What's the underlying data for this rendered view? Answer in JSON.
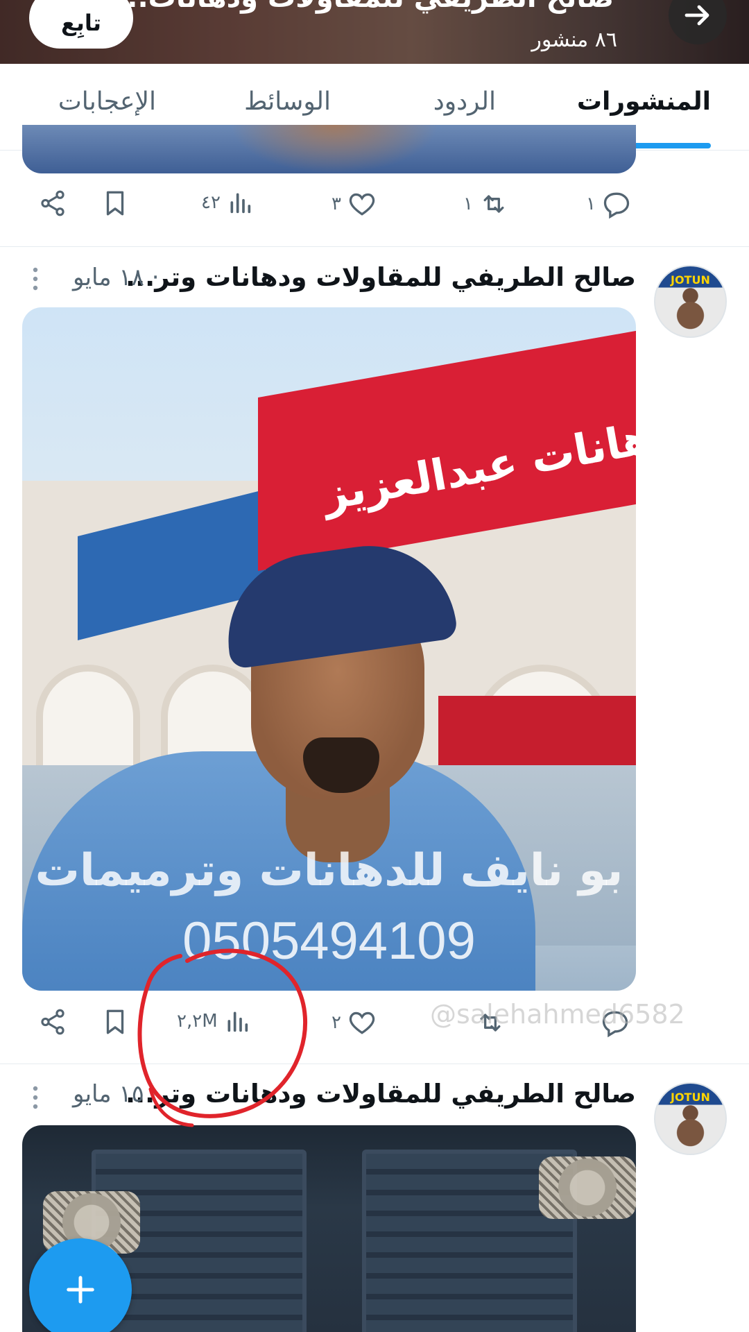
{
  "header": {
    "title": "صالح الطريفي للمقاولات ودهانات...",
    "post_count": "٨٦ منشور",
    "follow_label": "تابِع"
  },
  "tabs": [
    {
      "label": "المنشورات",
      "active": true
    },
    {
      "label": "الردود",
      "active": false
    },
    {
      "label": "الوسائط",
      "active": false
    },
    {
      "label": "الإعجابات",
      "active": false
    }
  ],
  "posts": [
    {
      "replies": "١",
      "reposts": "١",
      "likes": "٣",
      "views": "٤٢"
    },
    {
      "author": "صالح الطريفي للمقاولات ودهانات وتر...",
      "date": "· ١٨ مايو",
      "avatar_text": "JOTUN",
      "media_text_line1": "بو نايف للدهانات وترميمات",
      "media_text_line2": "0505494109",
      "shop_sign": "دهانات عبدالعزيز",
      "likes": "٢",
      "views": "٢,٢M"
    },
    {
      "author": "صالح الطريفي للمقاولات ودهانات وتر...",
      "date": "· ١٥ مايو",
      "avatar_text": "JOTUN"
    }
  ],
  "watermark": "@salehahmed6582",
  "colors": {
    "accent": "#1d9bf0",
    "annotation": "#e0242b",
    "muted": "#536471"
  }
}
